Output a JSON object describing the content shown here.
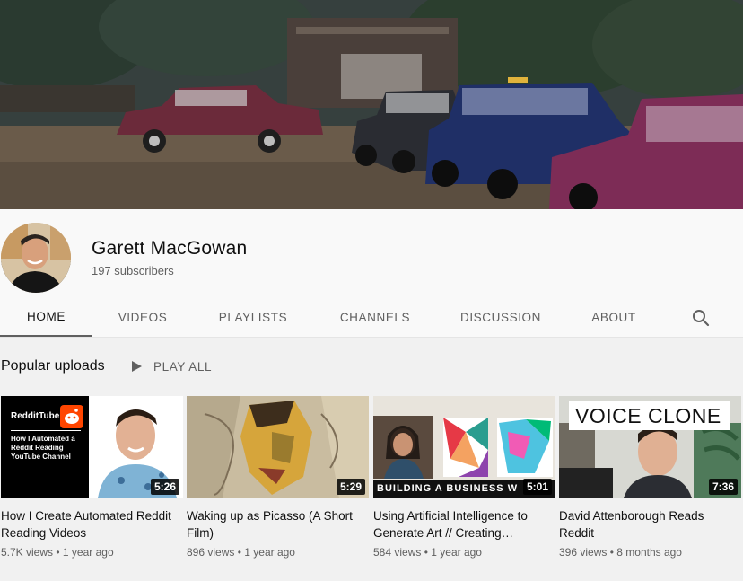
{
  "channel": {
    "name": "Garett MacGowan",
    "subscribers": "197 subscribers"
  },
  "tabs": [
    {
      "label": "HOME",
      "active": true
    },
    {
      "label": "VIDEOS"
    },
    {
      "label": "PLAYLISTS"
    },
    {
      "label": "CHANNELS"
    },
    {
      "label": "DISCUSSION"
    },
    {
      "label": "ABOUT"
    }
  ],
  "icons": {
    "search": "search-icon",
    "play": "play-icon"
  },
  "shelf": {
    "title": "Popular uploads",
    "play_all": "PLAY ALL"
  },
  "videos": [
    {
      "title": "How I Create Automated Reddit Reading Videos",
      "views": "5.7K views",
      "age": "1 year ago",
      "duration": "5:26",
      "thumb_brand": "RedditTube",
      "thumb_caption": "How I Automated a Reddit Reading YouTube Channel"
    },
    {
      "title": "Waking up as Picasso (A Short Film)",
      "views": "896 views",
      "age": "1 year ago",
      "duration": "5:29"
    },
    {
      "title": "Using Artificial Intelligence to Generate Art // Creating…",
      "views": "584 views",
      "age": "1 year ago",
      "duration": "5:01",
      "thumb_caption": "BUILDING A BUSINESS W"
    },
    {
      "title": "David Attenborough Reads Reddit",
      "views": "396 views",
      "age": "8 months ago",
      "duration": "7:36",
      "thumb_caption": "VOICE CLONE"
    }
  ],
  "separator": "•",
  "colors": {
    "background": "#f9f9f9",
    "shelf_background": "#f1f1f1",
    "secondary_text": "#606060",
    "reddit_orange": "#ff4500"
  }
}
